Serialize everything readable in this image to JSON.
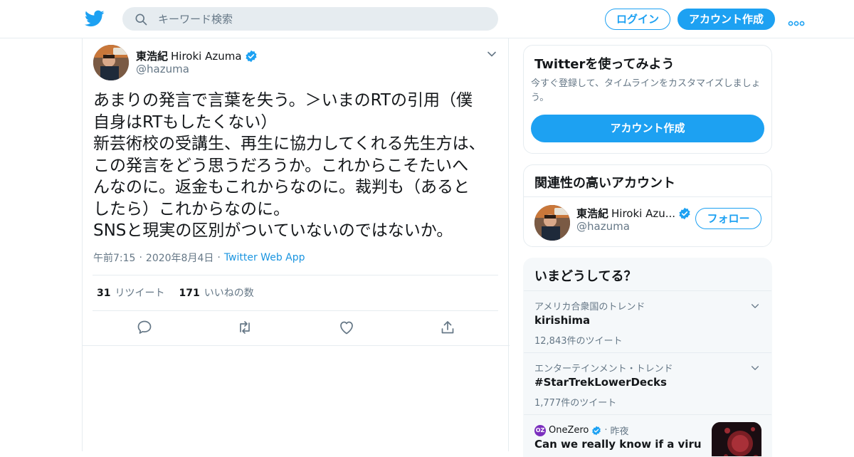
{
  "topbar": {
    "search_placeholder": "キーワード検索",
    "login_label": "ログイン",
    "signup_label": "アカウント作成"
  },
  "tweet": {
    "author_name_jp": "東浩紀",
    "author_name_en": "Hiroki Azuma",
    "handle": "@hazuma",
    "text": "あまりの発言で言葉を失う。＞いまのRTの引用（僕\n自身はRTもしたくない）\n新芸術校の受講生、再生に協力してくれる先生方は、\nこの発言をどう思うだろうか。これからこそたいへ\nんなのに。返金もこれからなのに。裁判も（あると\nしたら）これからなのに。\nSNSと現実の区別がついていないのではないか。",
    "time": "午前7:15",
    "date": "2020年8月4日",
    "via": "Twitter Web App",
    "retweet_count": "31",
    "retweet_label": "リツイート",
    "like_count": "171",
    "like_label": "いいねの数"
  },
  "signup_card": {
    "title": "Twitterを使ってみよう",
    "description": "今すぐ登録して、タイムラインをカスタマイズしましょう。",
    "button_label": "アカウント作成"
  },
  "related_card": {
    "title": "関連性の高いアカウント",
    "account": {
      "name_jp": "東浩紀",
      "name_en": "Hiroki Azu...",
      "handle": "@hazuma",
      "follow_label": "フォロー"
    }
  },
  "trends_card": {
    "title": "いまどうしてる？",
    "trends": [
      {
        "context": "アメリカ合衆国のトレンド",
        "name": "kirishima",
        "count": "12,843件のツイート"
      },
      {
        "context": "エンターテインメント・トレンド",
        "name": "#StarTrekLowerDecks",
        "count": "1,777件のツイート"
      }
    ],
    "news": {
      "source_logo": "OZ",
      "source": "OneZero",
      "time": "昨夜",
      "headline": "Can we really know if a virus was"
    }
  },
  "colors": {
    "accent": "#1da1f2",
    "link": "#1b95e0",
    "muted": "#657786",
    "text": "#14171a",
    "border": "#e6ecf0",
    "trend_bg": "#f5f8fa"
  }
}
